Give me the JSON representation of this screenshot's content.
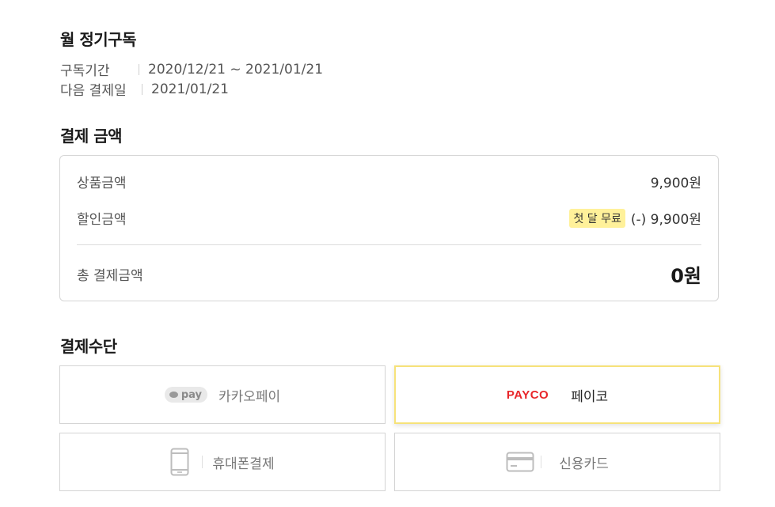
{
  "subscription": {
    "title": "월 정기구독",
    "period_label": "구독기간",
    "period_value": "2020/12/21 ~ 2021/01/21",
    "next_payment_label": "다음 결제일",
    "next_payment_value": "2021/01/21"
  },
  "payment_amount": {
    "heading": "결제 금액",
    "product_label": "상품금액",
    "product_value": "9,900원",
    "discount_label": "할인금액",
    "discount_badge": "첫 달 무료",
    "discount_value": "(-) 9,900원",
    "total_label": "총 결제금액",
    "total_value": "0원"
  },
  "payment_method": {
    "heading": "결제수단",
    "options": [
      {
        "logo_text": "pay",
        "label": "카카오페이",
        "icon": "kakaopay-logo",
        "selected": false
      },
      {
        "logo_text": "PAYCO",
        "label": "페이코",
        "icon": "payco-logo",
        "selected": true
      },
      {
        "label": "휴대폰결제",
        "icon": "mobile-phone-icon",
        "selected": false
      },
      {
        "label": "신용카드",
        "icon": "credit-card-icon",
        "selected": false
      }
    ]
  },
  "colors": {
    "badge_bg": "#fff19a",
    "selected_border": "#f6e27a",
    "payco_red": "#e8262a"
  }
}
